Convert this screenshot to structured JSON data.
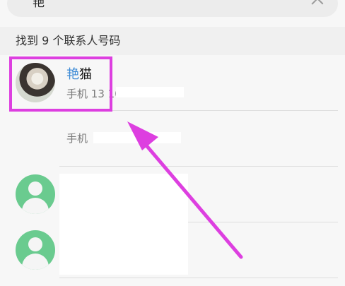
{
  "search": {
    "query": "艳"
  },
  "section": {
    "title": "找到 9 个联系人号码"
  },
  "contacts": [
    {
      "name_highlight": "艳",
      "name_rest": "猫",
      "phone_label": "手机",
      "phone_value": "13  1040 0120"
    },
    {
      "phone_label": "手机"
    },
    {},
    {}
  ],
  "colors": {
    "highlight_box": "#dd3fe0",
    "search_match": "#3d8bd6",
    "default_avatar": "#6acb8f"
  }
}
